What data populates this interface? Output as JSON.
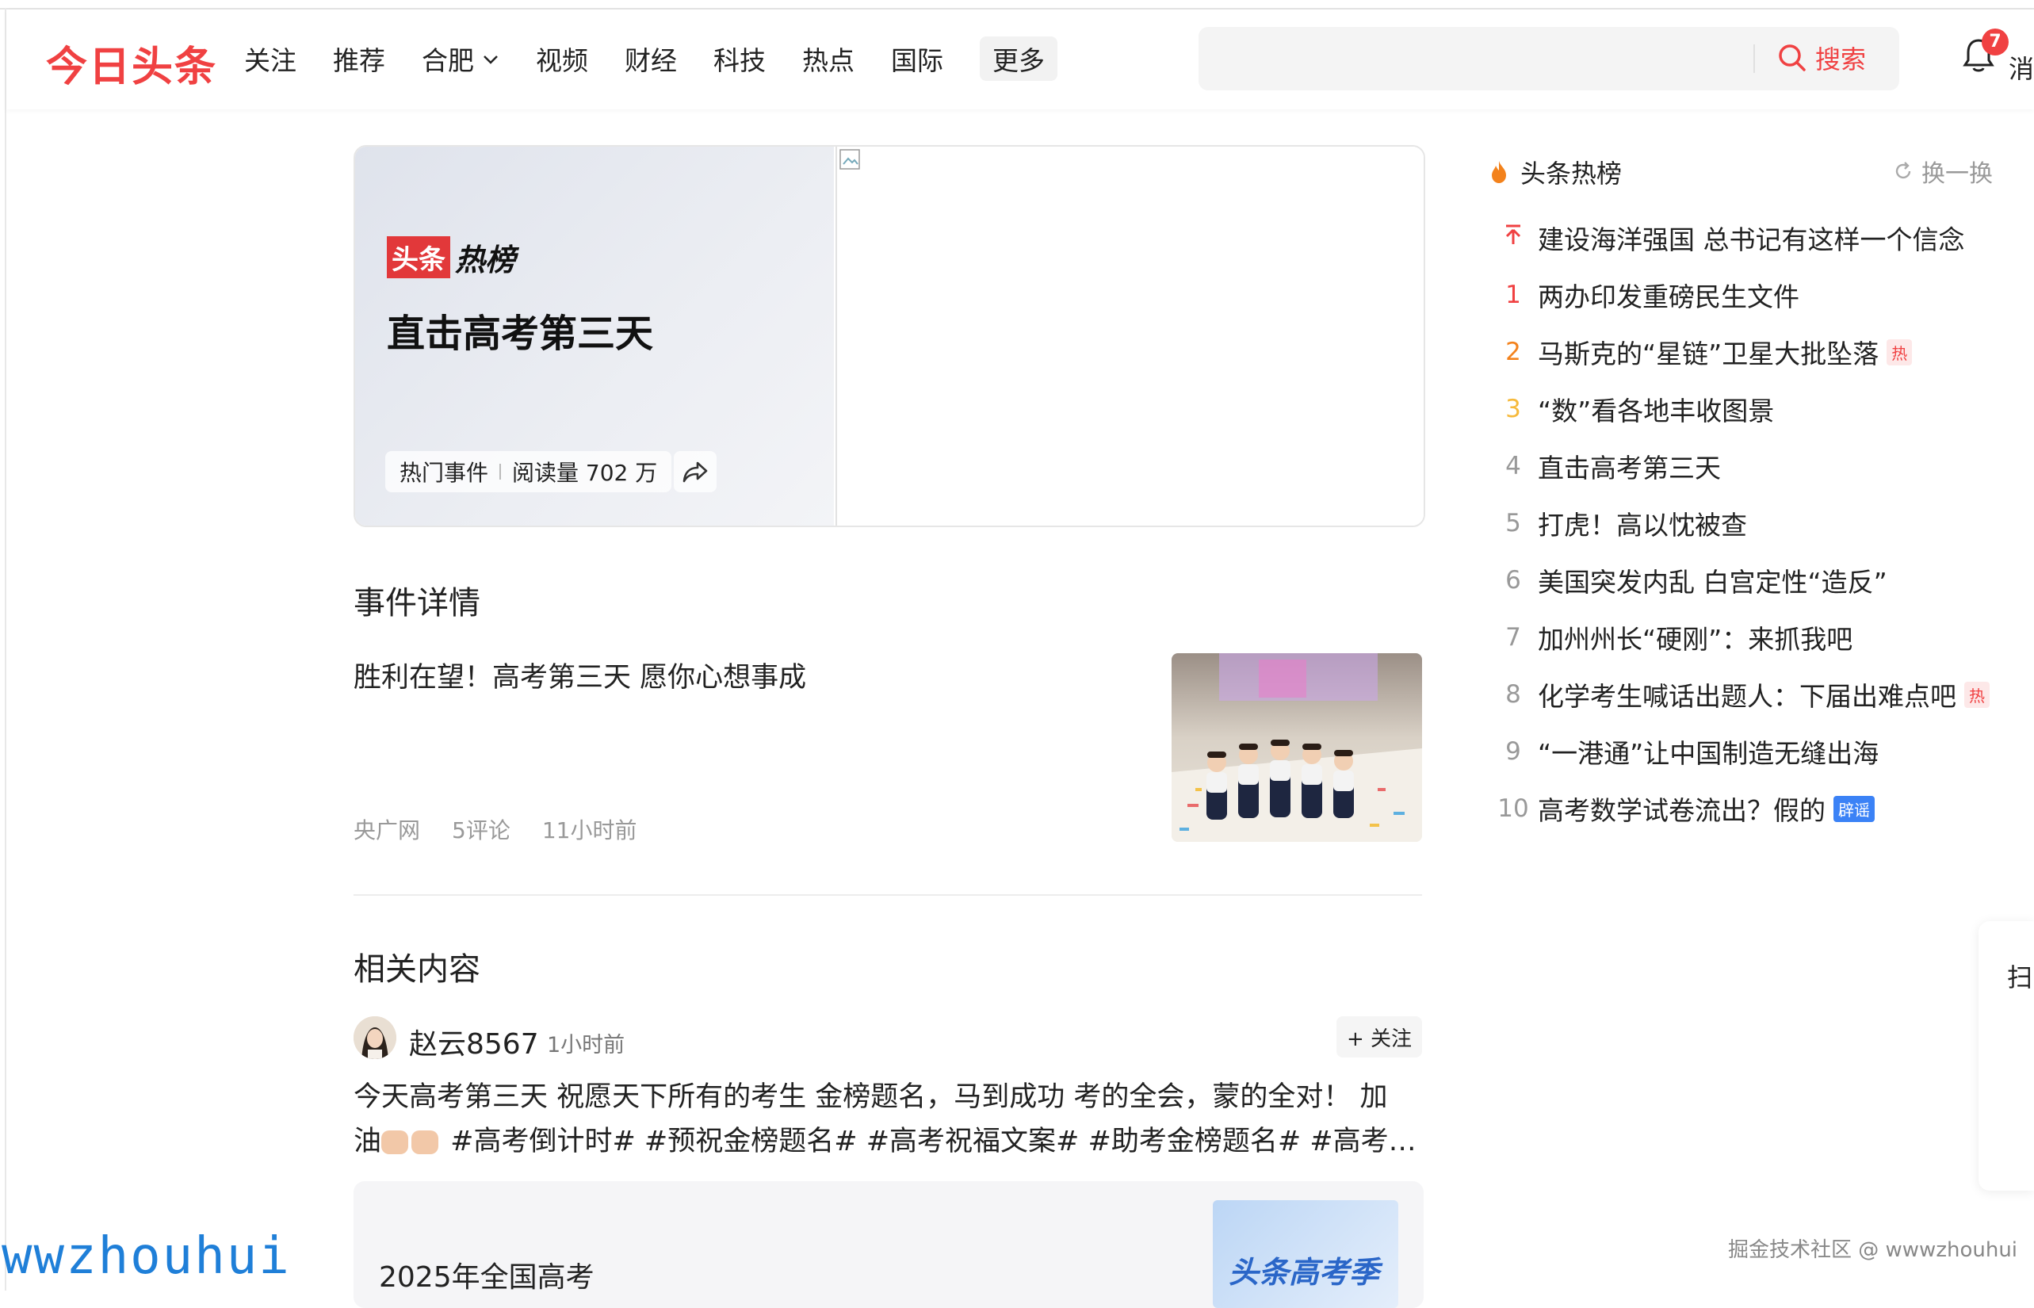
{
  "header": {
    "logo": "今日头条",
    "nav": [
      "关注",
      "推荐",
      "合肥",
      "视频",
      "财经",
      "科技",
      "热点",
      "国际"
    ],
    "nav_more": "更多",
    "search": {
      "placeholder": "",
      "button": "搜索"
    },
    "notification": {
      "badge": "7",
      "label": "消"
    }
  },
  "hero": {
    "brand_left": "头条",
    "brand_right": "热榜",
    "title": "直击高考第三天",
    "category": "热门事件",
    "reads": "阅读量 702 万"
  },
  "event_details": {
    "heading": "事件详情",
    "article": {
      "title": "胜利在望！高考第三天 愿你心想事成",
      "source": "央广网",
      "comments": "5评论",
      "time": "11小时前"
    }
  },
  "related": {
    "heading": "相关内容",
    "post": {
      "author": "赵云8567",
      "time": "1小时前",
      "follow": "+ 关注",
      "line1": "今天高考第三天 祝愿天下所有的考生 金榜题名，马到成功 考的全会，蒙的全对！ 加",
      "line2_prefix": "油",
      "line2": "#高考倒计时# #预祝金榜题名# #高考祝福文案# #助考金榜题名# #高考喜...",
      "embed_title": "2025年全国高考",
      "embed_thumb_text": "头条高考季"
    }
  },
  "hot": {
    "title": "头条热榜",
    "refresh": "换一换",
    "items": [
      {
        "rank": "",
        "label": "建设海洋强国 总书记有这样一个信念",
        "tag": ""
      },
      {
        "rank": "1",
        "label": "两办印发重磅民生文件",
        "tag": ""
      },
      {
        "rank": "2",
        "label": "马斯克的“星链”卫星大批坠落",
        "tag": "热"
      },
      {
        "rank": "3",
        "label": "“数”看各地丰收图景",
        "tag": ""
      },
      {
        "rank": "4",
        "label": "直击高考第三天",
        "tag": ""
      },
      {
        "rank": "5",
        "label": "打虎！高以忱被查",
        "tag": ""
      },
      {
        "rank": "6",
        "label": "美国突发内乱 白宫定性“造反”",
        "tag": ""
      },
      {
        "rank": "7",
        "label": "加州州长“硬刚”：来抓我吧",
        "tag": ""
      },
      {
        "rank": "8",
        "label": "化学考生喊话出题人：下届出难点吧",
        "tag": "热"
      },
      {
        "rank": "9",
        "label": "“一港通”让中国制造无缝出海",
        "tag": ""
      },
      {
        "rank": "10",
        "label": "高考数学试卷流出？假的",
        "tag": "辟谣"
      }
    ],
    "rank_colors": {
      "1": "#f04142",
      "2": "#f3821c",
      "3": "#f6b93b",
      "default": "#999999"
    }
  },
  "side_float": {
    "label": "扫"
  },
  "watermarks": {
    "left": "wwzhouhui",
    "right": "掘金技术社区 @ wwwzhouhui"
  },
  "colors": {
    "accent": "#f04142",
    "rumor": "#3b82f6"
  }
}
